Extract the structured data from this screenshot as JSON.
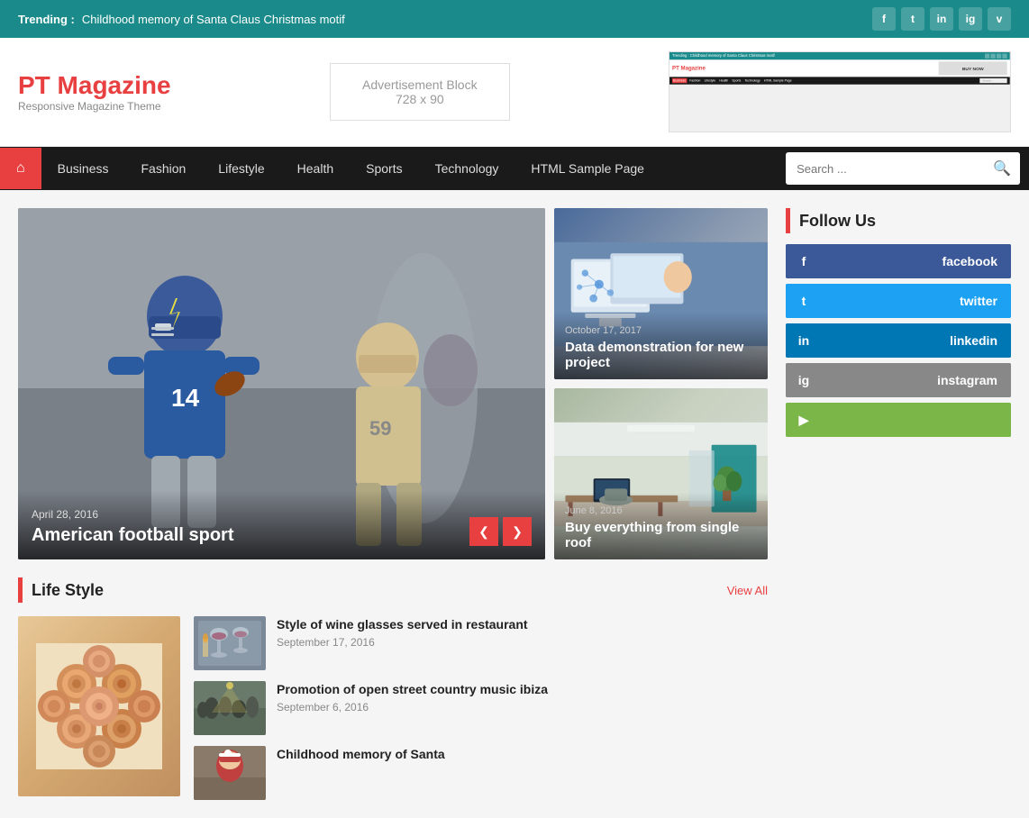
{
  "trending": {
    "label": "Trending :",
    "text": "Childhood memory of Santa Claus Christmas motif"
  },
  "social_top": {
    "facebook": "f",
    "twitter": "t",
    "linkedin": "in",
    "instagram": "ig",
    "vimeo": "v"
  },
  "header": {
    "logo_title": "PT Magazine",
    "logo_sub": "Responsive Magazine Theme",
    "ad_title": "Advertisement Block",
    "ad_size": "728 x 90",
    "buy_now": "BUY NOW"
  },
  "nav": {
    "home_icon": "⌂",
    "items": [
      {
        "label": "Business"
      },
      {
        "label": "Fashion"
      },
      {
        "label": "Lifestyle"
      },
      {
        "label": "Health"
      },
      {
        "label": "Sports"
      },
      {
        "label": "Technology"
      },
      {
        "label": "HTML Sample Page"
      }
    ],
    "search_placeholder": "Search ..."
  },
  "hero": {
    "main": {
      "date": "April 28, 2016",
      "title": "American football sport"
    },
    "card1": {
      "date": "October 17, 2017",
      "title": "Data demonstration for new project"
    },
    "card2": {
      "date": "June 8, 2016",
      "title": "Buy everything from single roof"
    }
  },
  "lifestyle": {
    "section_title": "Life Style",
    "view_all": "View All",
    "articles": [
      {
        "title": "Style of wine glasses served in restaurant",
        "date": "September 17, 2016"
      },
      {
        "title": "Promotion of open street country music ibiza",
        "date": "September 6, 2016"
      },
      {
        "title": "Childhood memory of Santa",
        "date": ""
      }
    ]
  },
  "follow": {
    "section_title": "Follow Us",
    "platforms": [
      {
        "name": "facebook",
        "label": "facebook",
        "icon": "f"
      },
      {
        "name": "twitter",
        "label": "twitter",
        "icon": "t"
      },
      {
        "name": "linkedin",
        "label": "linkedin",
        "icon": "in"
      },
      {
        "name": "instagram",
        "label": "instagram",
        "icon": "ig"
      }
    ]
  },
  "preview": {
    "trending": "Trending : Childhood memory of Santa Claus Christmas motif",
    "logo": "PT Magazine",
    "buy": "BUY NOW",
    "nav_items": [
      "Business",
      "Fashion",
      "Lifestyle",
      "Health",
      "Sports",
      "Technology",
      "HTML Sample Page"
    ]
  }
}
